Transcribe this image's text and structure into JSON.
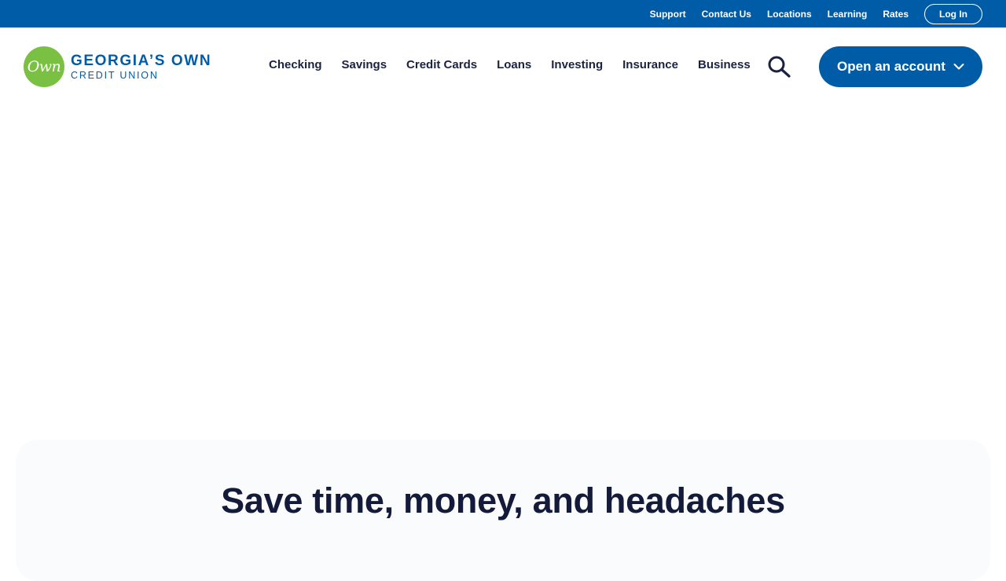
{
  "utility_nav": {
    "links": [
      "Support",
      "Contact Us",
      "Locations",
      "Learning",
      "Rates"
    ],
    "login_label": "Log In"
  },
  "logo": {
    "badge": "Own",
    "line1": "GEORGIA’S OWN",
    "line2": "CREDIT UNION"
  },
  "main_nav": {
    "items": [
      "Checking",
      "Savings",
      "Credit Cards",
      "Loans",
      "Investing",
      "Insurance",
      "Business"
    ]
  },
  "cta": {
    "open_account_label": "Open an account"
  },
  "feature": {
    "heading": "Save time, money, and headaches"
  },
  "colors": {
    "brand_blue": "#005ca6",
    "brand_green": "#7ac143",
    "text_dark": "#1b2240"
  },
  "icons": {
    "search": "search-icon",
    "chevron": "chevron-down-icon"
  }
}
